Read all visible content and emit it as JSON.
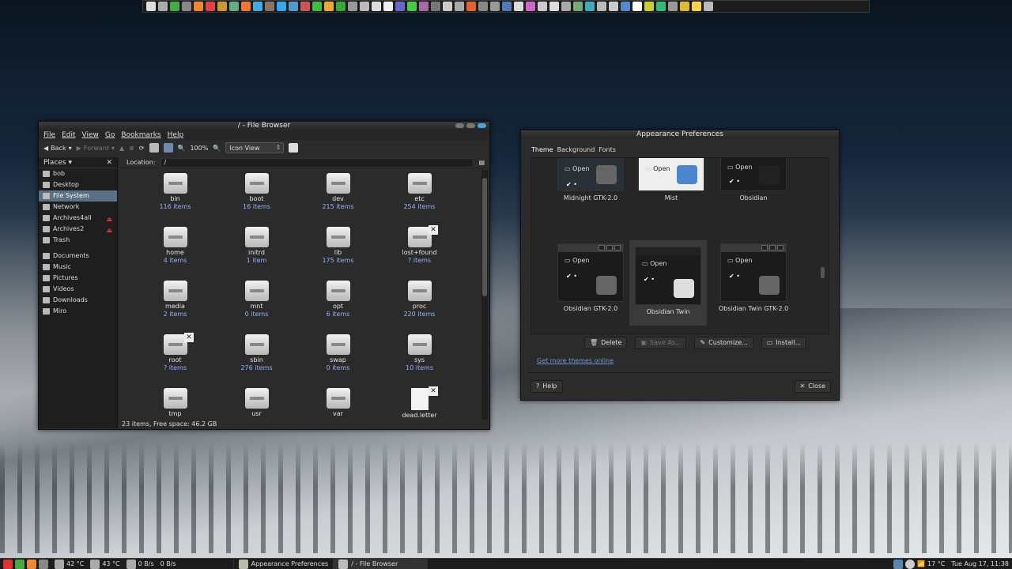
{
  "dock": {
    "icons": [
      "menu-icon",
      "terminal-icon",
      "files-icon",
      "spreadsheet-icon",
      "tool-icon",
      "firefox-icon",
      "pdf-icon",
      "folder-icon",
      "firefox-icon",
      "globe-icon",
      "gimp-icon",
      "skype-icon",
      "web-icon",
      "download-icon",
      "chrome-icon",
      "paint-icon",
      "torrent-icon",
      "pen-icon",
      "disk-icon",
      "search-icon",
      "document-icon",
      "text-icon",
      "network-icon",
      "graph-icon",
      "archive-icon",
      "settings-icon",
      "keyboard-icon",
      "media-icon",
      "wrench-icon",
      "clock-icon",
      "monitor-icon",
      "editor-icon",
      "user-icon",
      "app-icon",
      "mail-icon",
      "gear-icon",
      "game-icon",
      "camera-icon",
      "print-icon",
      "disc-icon",
      "explorer-icon",
      "screen-icon",
      "notes-icon",
      "books-icon",
      "folder-icon",
      "pencil-icon",
      "moon-icon",
      "person-icon"
    ]
  },
  "fb": {
    "title": "/ - File Browser",
    "menu": [
      "File",
      "Edit",
      "View",
      "Go",
      "Bookmarks",
      "Help"
    ],
    "back": "Back",
    "forward": "Forward",
    "zoom": "100%",
    "view": "Icon View",
    "places": "Places",
    "places_items": [
      {
        "label": "bob"
      },
      {
        "label": "Desktop"
      },
      {
        "label": "File System"
      },
      {
        "label": "Network"
      },
      {
        "label": "Archives4all"
      },
      {
        "label": "Archives2"
      },
      {
        "label": "Trash"
      }
    ],
    "bookmarks": [
      {
        "label": "Documents"
      },
      {
        "label": "Music"
      },
      {
        "label": "Pictures"
      },
      {
        "label": "Videos"
      },
      {
        "label": "Downloads"
      },
      {
        "label": "Miro"
      }
    ],
    "location_label": "Location:",
    "location": "/",
    "files": [
      {
        "name": "bin",
        "count": "116 items"
      },
      {
        "name": "boot",
        "count": "16 items"
      },
      {
        "name": "dev",
        "count": "215 items"
      },
      {
        "name": "etc",
        "count": "254 items"
      },
      {
        "name": "home",
        "count": "4 items"
      },
      {
        "name": "initrd",
        "count": "1 item"
      },
      {
        "name": "lib",
        "count": "175 items"
      },
      {
        "name": "lost+found",
        "count": "? items"
      },
      {
        "name": "media",
        "count": "2 items"
      },
      {
        "name": "mnt",
        "count": "0 items"
      },
      {
        "name": "opt",
        "count": "6 items"
      },
      {
        "name": "proc",
        "count": "220 items"
      },
      {
        "name": "root",
        "count": "? items"
      },
      {
        "name": "sbin",
        "count": "276 items"
      },
      {
        "name": "swap",
        "count": "0 items"
      },
      {
        "name": "sys",
        "count": "10 items"
      },
      {
        "name": "tmp",
        "count": ""
      },
      {
        "name": "usr",
        "count": ""
      },
      {
        "name": "var",
        "count": ""
      },
      {
        "name": "dead.letter",
        "count": ""
      }
    ],
    "status": "23 items, Free space: 46.2 GB"
  },
  "ap": {
    "title": "Appearance Preferences",
    "tabs": [
      "Theme",
      "Background",
      "Fonts"
    ],
    "themes": [
      {
        "name": "Midnight GTK-2.0",
        "open": "Open"
      },
      {
        "name": "Mist",
        "open": "Open"
      },
      {
        "name": "Obsidian",
        "open": "Open"
      },
      {
        "name": "Obsidian GTK-2.0",
        "open": "Open"
      },
      {
        "name": "Obsidian Twin",
        "open": "Open"
      },
      {
        "name": "Obsidian Twin GTK-2.0",
        "open": "Open"
      }
    ],
    "buttons": {
      "delete": "Delete",
      "save": "Save As...",
      "customize": "Customize...",
      "install": "Install..."
    },
    "link": "Get more themes online",
    "help": "Help",
    "close": "Close"
  },
  "taskbar": {
    "cpu_temp": "42 °C",
    "gpu_temp": "43 °C",
    "net_down": "0 B/s",
    "net_up": "0 B/s",
    "win1": "Appearance Preferences",
    "win2": "/ - File Browser",
    "weather": "17 °C",
    "clock": "Tue Aug 17, 11:38"
  }
}
